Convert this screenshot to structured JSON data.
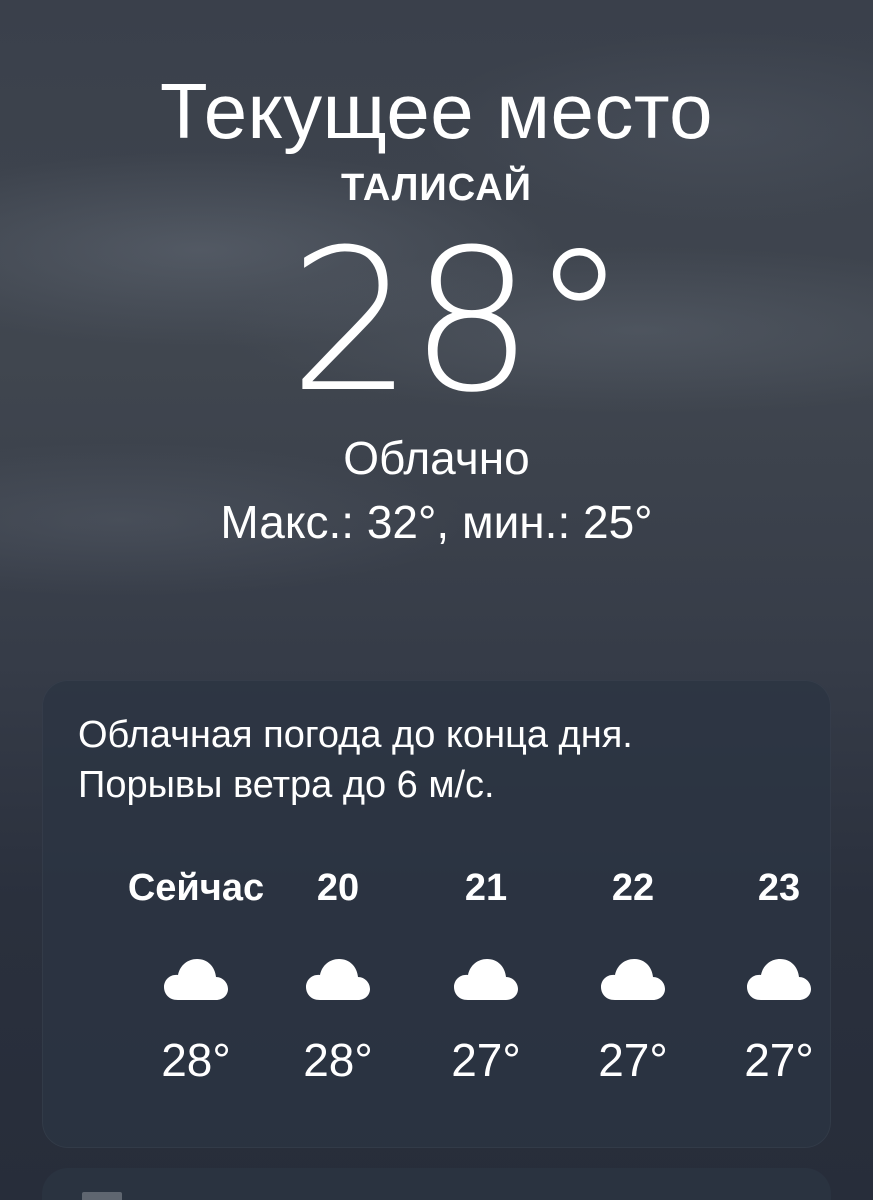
{
  "header": {
    "location_title": "Текущее место",
    "city": "ТАЛИСАЙ",
    "current_temp": "28°",
    "condition": "Облачно",
    "hilo": "Макс.: 32°, мин.: 25°"
  },
  "forecast_card": {
    "summary_line1": "Облачная погода до конца дня.",
    "summary_line2": "Порывы ветра до 6 м/с.",
    "hours": [
      {
        "label": "Сейчас",
        "icon": "cloud-icon",
        "temp": "28°"
      },
      {
        "label": "20",
        "icon": "cloud-icon",
        "temp": "28°"
      },
      {
        "label": "21",
        "icon": "cloud-icon",
        "temp": "27°"
      },
      {
        "label": "22",
        "icon": "cloud-icon",
        "temp": "27°"
      },
      {
        "label": "23",
        "icon": "cloud-icon",
        "temp": "27°"
      }
    ]
  },
  "colors": {
    "text": "#ffffff",
    "card_bg": "#2c3442",
    "sky_top": "#3a404b",
    "sky_bottom": "#272d3a"
  }
}
